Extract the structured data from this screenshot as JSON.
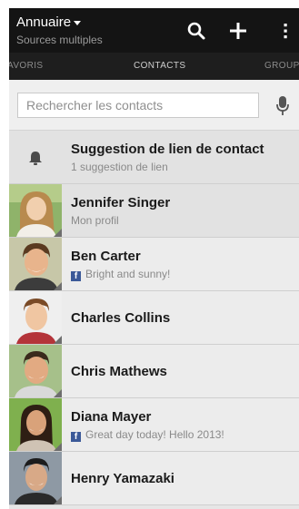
{
  "appbar": {
    "title": "Annuaire",
    "subtitle": "Sources multiples",
    "icons": [
      "caret-down-icon",
      "search-icon",
      "plus-icon",
      "overflow-menu-icon"
    ]
  },
  "tabs": [
    {
      "label": "AVORIS"
    },
    {
      "label": "CONTACTS"
    },
    {
      "label": "GROUP"
    }
  ],
  "search": {
    "placeholder": "Rechercher les contacts",
    "icon": "microphone-icon"
  },
  "suggestion": {
    "title": "Suggestion de lien de contact",
    "subtitle": "1 suggestion de lien",
    "icon": "bell-icon"
  },
  "contacts": [
    {
      "name": "Jennifer Singer",
      "status": "Mon profil",
      "facebook": false
    },
    {
      "name": "Ben Carter",
      "status": "Bright and sunny!",
      "facebook": true
    },
    {
      "name": "Charles Collins",
      "status": "",
      "facebook": false
    },
    {
      "name": "Chris Mathews",
      "status": "",
      "facebook": false
    },
    {
      "name": "Diana Mayer",
      "status": "Great day today! Hello 2013!",
      "facebook": true
    },
    {
      "name": "Henry Yamazaki",
      "status": "",
      "facebook": false
    }
  ],
  "colors": {
    "appbar": "#141414",
    "tabbar": "#1e1e1e",
    "list": "#ececec",
    "facebook": "#3b5998"
  }
}
